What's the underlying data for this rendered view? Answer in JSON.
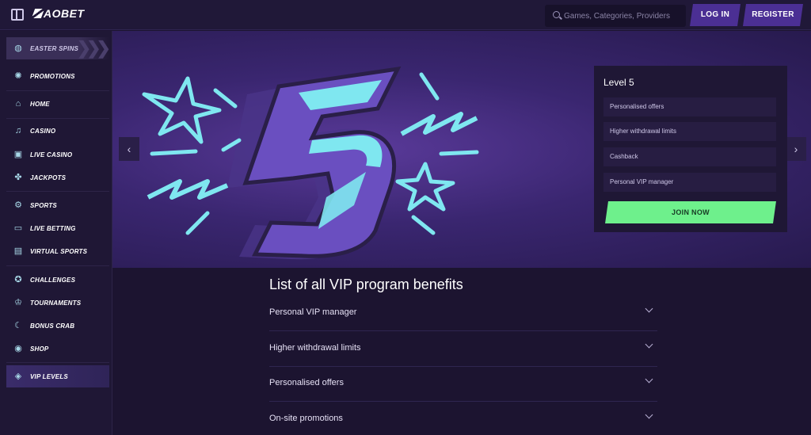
{
  "header": {
    "logo_text": "AOBET",
    "search_placeholder": "Games, Categories, Providers",
    "login_label": "LOG IN",
    "register_label": "REGISTER"
  },
  "sidebar": {
    "items": [
      {
        "label": "EASTER SPINS",
        "icon": "egg-icon"
      },
      {
        "label": "PROMOTIONS",
        "icon": "promo-icon"
      },
      {
        "label": "HOME",
        "icon": "home-icon"
      },
      {
        "label": "CASINO",
        "icon": "music-note-icon"
      },
      {
        "label": "LIVE CASINO",
        "icon": "cards-icon"
      },
      {
        "label": "JACKPOTS",
        "icon": "clover-icon"
      },
      {
        "label": "SPORTS",
        "icon": "sports-icon"
      },
      {
        "label": "LIVE BETTING",
        "icon": "live-icon"
      },
      {
        "label": "VIRTUAL SPORTS",
        "icon": "virtual-icon"
      },
      {
        "label": "CHALLENGES",
        "icon": "medal-icon"
      },
      {
        "label": "TOURNAMENTS",
        "icon": "trophy-icon"
      },
      {
        "label": "BONUS CRAB",
        "icon": "crab-icon"
      },
      {
        "label": "SHOP",
        "icon": "basket-icon"
      },
      {
        "label": "VIP LEVELS",
        "icon": "diamond-icon",
        "active": true
      }
    ]
  },
  "banner": {
    "level_title": "Level 5",
    "benefits": [
      "Personalised offers",
      "Higher withdrawal limits",
      "Cashback",
      "Personal VIP manager"
    ],
    "join_label": "JOIN NOW",
    "accent_color": "#6ef08c"
  },
  "benefits_list": {
    "title": "List of all VIP program benefits",
    "items": [
      "Personal VIP manager",
      "Higher withdrawal limits",
      "Personalised offers",
      "On-site promotions"
    ]
  }
}
